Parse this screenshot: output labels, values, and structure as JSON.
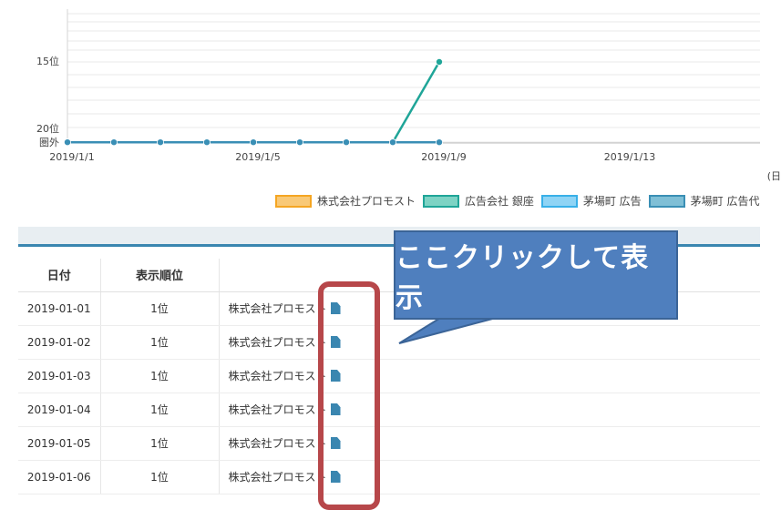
{
  "chart_data": {
    "type": "line",
    "x": [
      "2019/1/1",
      "2019/1/2",
      "2019/1/3",
      "2019/1/4",
      "2019/1/5",
      "2019/1/6",
      "2019/1/7",
      "2019/1/8",
      "2019/1/9"
    ],
    "x_tick_labels": [
      "2019/1/1",
      "2019/1/5",
      "2019/1/9",
      "2019/1/13"
    ],
    "y_tick_labels": [
      "15位",
      "20位",
      "圏外"
    ],
    "xlabel_fragment": "(日",
    "series": [
      {
        "name": "株式会社プロモスト",
        "color": "#f5a623",
        "values": [
          21,
          21,
          21,
          21,
          21,
          21,
          21,
          21,
          21
        ]
      },
      {
        "name": "広告会社 銀座",
        "color": "#1fa598",
        "values": [
          null,
          null,
          null,
          null,
          null,
          null,
          null,
          21,
          15
        ]
      },
      {
        "name": "茅場町 広告",
        "color": "#38b0e8",
        "values": [
          21,
          21,
          21,
          21,
          21,
          21,
          21,
          21,
          21
        ]
      },
      {
        "name": "茅場町 広告代",
        "color": "#3a8fb5",
        "values": [
          21,
          21,
          21,
          21,
          21,
          21,
          21,
          21,
          21
        ]
      }
    ],
    "legend_position": "bottom",
    "grid": true
  },
  "legend": [
    {
      "label": "株式会社プロモスト",
      "fill": "#f9c977",
      "border": "#f5a623"
    },
    {
      "label": "広告会社 銀座",
      "fill": "#7dd3c4",
      "border": "#1fa598"
    },
    {
      "label": "茅場町 広告",
      "fill": "#8fd4f5",
      "border": "#38b0e8"
    },
    {
      "label": "茅場町 広告代",
      "fill": "#7fbfd6",
      "border": "#3a8fb5"
    }
  ],
  "table": {
    "headers": {
      "date": "日付",
      "rank": "表示順位",
      "site": ""
    },
    "rows": [
      {
        "date": "2019-01-01",
        "rank": "1位",
        "site": "株式会社プロモスト"
      },
      {
        "date": "2019-01-02",
        "rank": "1位",
        "site": "株式会社プロモスト"
      },
      {
        "date": "2019-01-03",
        "rank": "1位",
        "site": "株式会社プロモスト"
      },
      {
        "date": "2019-01-04",
        "rank": "1位",
        "site": "株式会社プロモスト"
      },
      {
        "date": "2019-01-05",
        "rank": "1位",
        "site": "株式会社プロモスト"
      },
      {
        "date": "2019-01-06",
        "rank": "1位",
        "site": "株式会社プロモスト"
      }
    ]
  },
  "callout": {
    "text": "ここクリックして表示"
  },
  "colors": {
    "accent": "#3a86b0",
    "callout": "#4f7fbe",
    "highlight": "#b7474a"
  }
}
